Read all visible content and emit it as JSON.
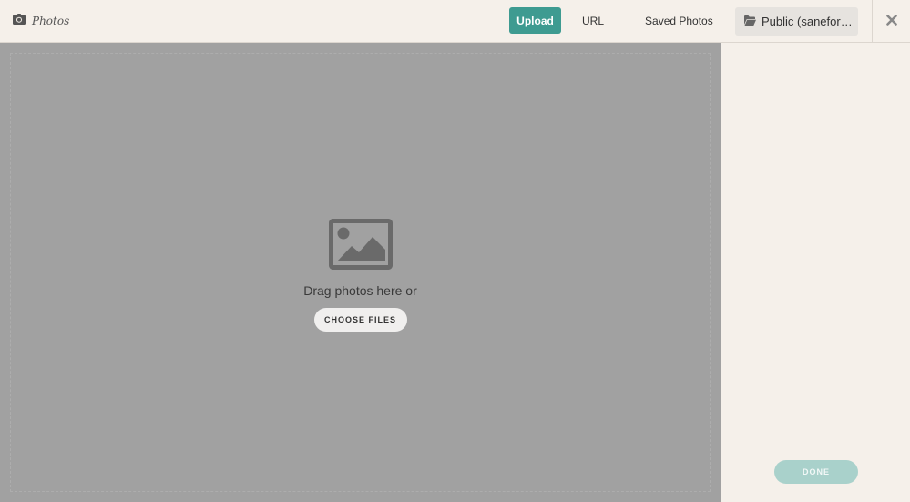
{
  "header": {
    "brand_label": "Photos",
    "brand_icon": "camera-icon",
    "tabs": [
      {
        "label": "Upload",
        "active": true
      },
      {
        "label": "URL",
        "active": false
      },
      {
        "label": "Saved Photos",
        "active": false
      }
    ],
    "folder": {
      "label": "Public (saneforu...",
      "icon": "folder-open-icon"
    },
    "close_icon": "close-icon"
  },
  "main": {
    "drop_icon": "image-icon",
    "drag_text": "Drag photos here or",
    "choose_files_label": "CHOOSE FILES"
  },
  "sidebar": {
    "done_label": "DONE"
  },
  "colors": {
    "accent": "#3e9b91",
    "done_disabled": "#a9d1cb",
    "drop_bg": "#a1a1a1",
    "header_bg": "#f5f0ea"
  }
}
